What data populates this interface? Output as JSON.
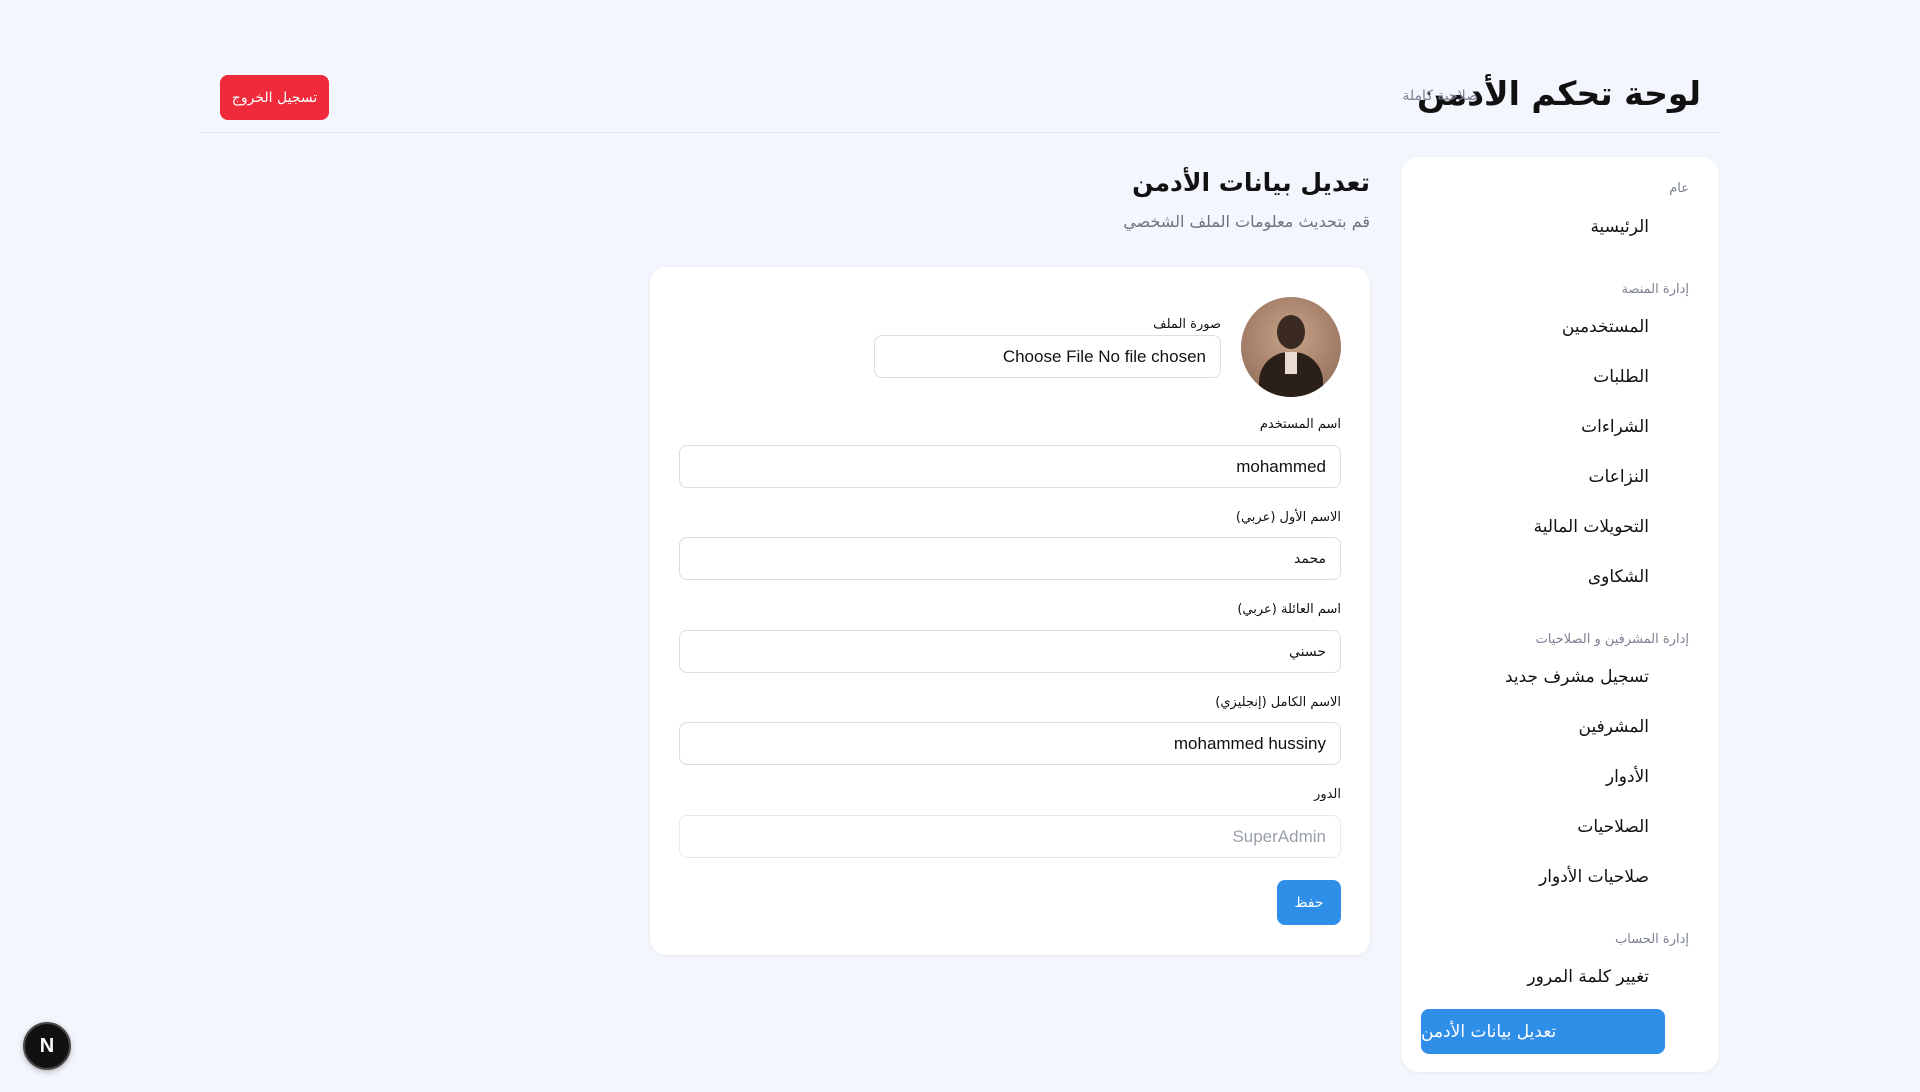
{
  "header": {
    "title": "لوحة تحكم الأدمن",
    "subtitle": "صلاحية كاملة",
    "logout_label": "تسجيل الخروج"
  },
  "sidebar": {
    "sections": [
      {
        "title": "عام",
        "items": [
          "الرئيسية"
        ]
      },
      {
        "title": "إدارة المنصة",
        "items": [
          "المستخدمين",
          "الطلبات",
          "الشراءات",
          "النزاعات",
          "التحويلات المالية",
          "الشكاوى"
        ]
      },
      {
        "title": "إدارة المشرفين و الصلاحيات",
        "items": [
          "تسجيل مشرف جديد",
          "المشرفين",
          "الأدوار",
          "الصلاحيات",
          "صلاحيات الأدوار"
        ]
      },
      {
        "title": "إدارة الحساب",
        "items": [
          "تغيير كلمة المرور",
          "تعديل بيانات الأدمن"
        ]
      }
    ],
    "active_item": "تعديل بيانات الأدمن"
  },
  "main": {
    "title": "تعديل بيانات الأدمن",
    "subtitle": "قم بتحديث معلومات الملف الشخصي"
  },
  "form": {
    "profile_image_label": "صورة الملف",
    "file_input_text": "Choose File No file chosen",
    "username_label": "اسم المستخدم",
    "username_value": "mohammed",
    "first_name_label": "الاسم الأول (عربي)",
    "first_name_value": "محمد",
    "family_name_label": "اسم العائلة (عربي)",
    "family_name_value": "حسني",
    "full_name_label": "الاسم الكامل (إنجليزي)",
    "full_name_value": "mohammed hussiny",
    "role_label": "الدور",
    "role_value": "SuperAdmin",
    "save_label": "حفظ"
  },
  "badge": {
    "text": "N"
  },
  "colors": {
    "accent": "#2f8ee8",
    "danger": "#ef2a3a",
    "background": "#f3f6fc"
  }
}
